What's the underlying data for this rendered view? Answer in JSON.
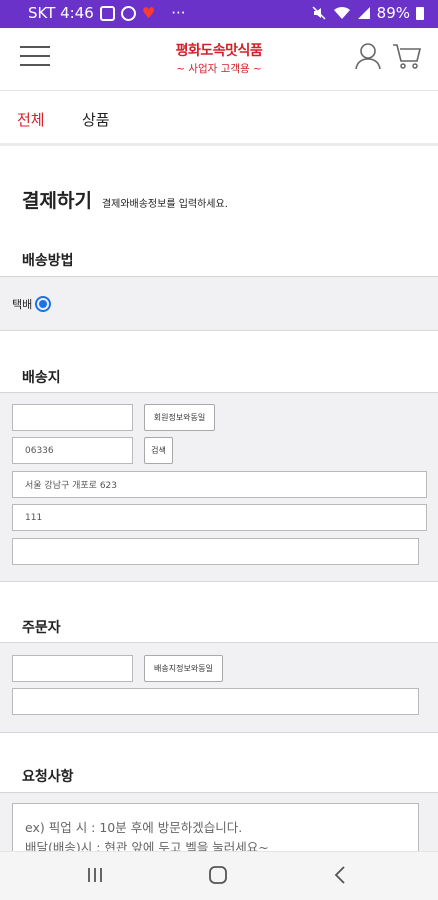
{
  "status_bar": {
    "carrier_time": "SKT 4:46",
    "dots": "···",
    "battery": "89%"
  },
  "header": {
    "brand_name": "평화도속맛식품",
    "brand_sub": "~ 사업자 고객용 ~",
    "icons": [
      "hamburger-menu-icon",
      "user-icon",
      "cart-icon"
    ]
  },
  "tabs": [
    {
      "label": "전체",
      "active": true
    },
    {
      "label": "상품",
      "active": false
    }
  ],
  "page": {
    "title": "결제하기",
    "subtitle": "결제와배송정보를 입력하세요."
  },
  "shipping_method": {
    "title": "배송방법",
    "option_label": "택배",
    "selected": true
  },
  "destination": {
    "title": "배송지",
    "name_value": "",
    "same_as_member_button": "회원정보와동일",
    "postcode": "06336",
    "search_button": "검색",
    "address": "서울 강남구 개포로 623",
    "address_detail": "111",
    "extra": ""
  },
  "orderer": {
    "title": "주문자",
    "name_value": "",
    "same_as_shipping_button": "배송지정보와동일",
    "phone_value": ""
  },
  "request": {
    "title": "요청사항",
    "line1": "ex) 픽업 시 : 10분 후에 방문하겠습니다.",
    "line2": "배달(배송)시 : 현관 앞에 두고 벨을 눌러세요~"
  },
  "colors": {
    "brand_red": "#d4202b",
    "status_purple": "#6a32c9",
    "panel_gray": "#f1f1f3",
    "radio_blue": "#1a73e8"
  }
}
